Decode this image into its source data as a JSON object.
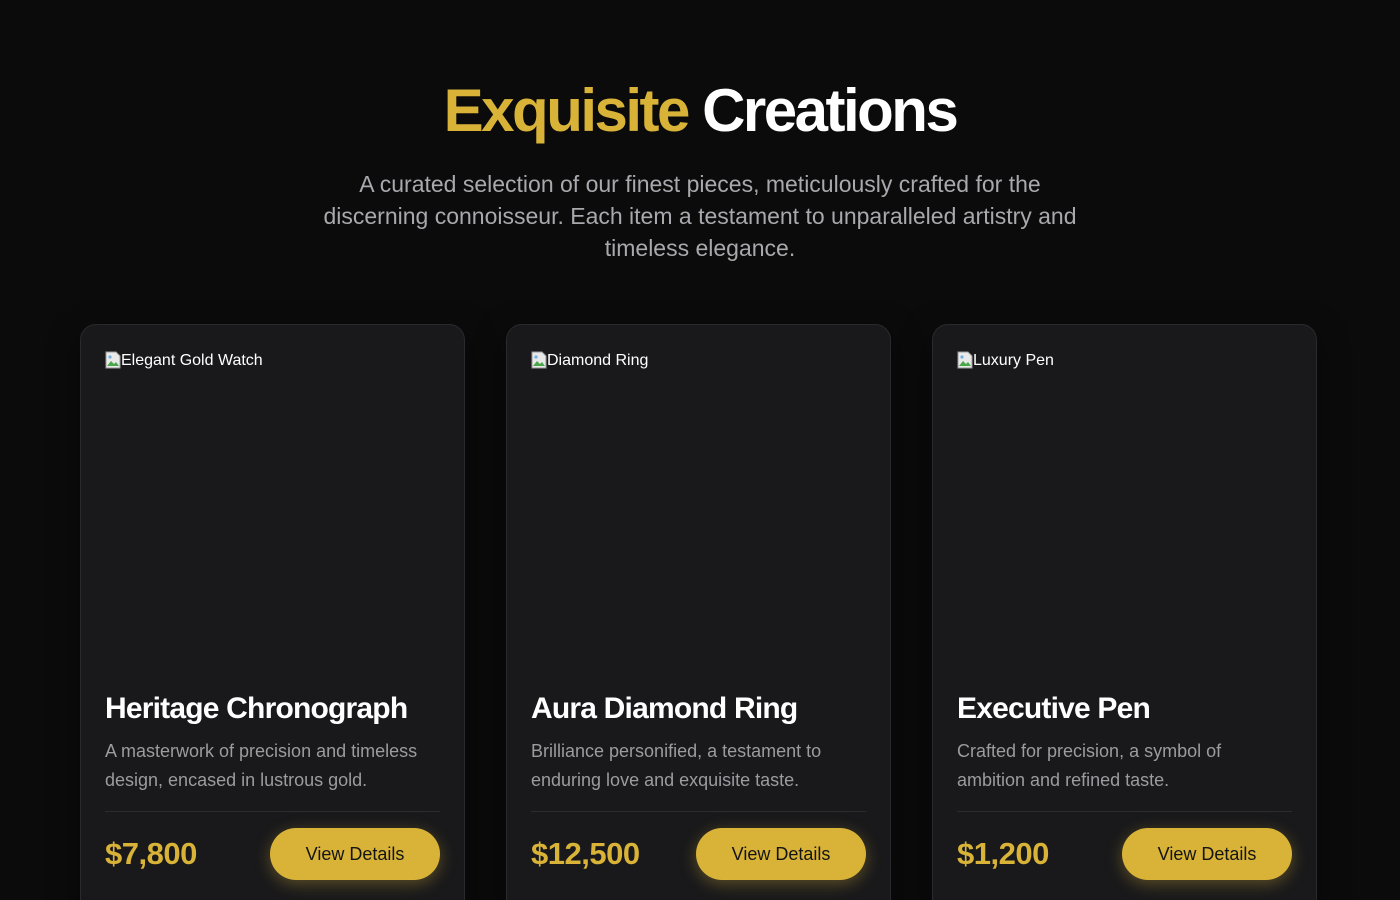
{
  "hero": {
    "title_accent": "Exquisite",
    "title_rest": "Creations",
    "subtitle": "A curated selection of our finest pieces, meticulously crafted for the discerning connoisseur. Each item a testament to unparalleled artistry and timeless elegance."
  },
  "products": [
    {
      "image_alt": "Elegant Gold Watch",
      "name": "Heritage Chronograph",
      "description": "A masterwork of precision and timeless design, encased in lustrous gold.",
      "price": "$7,800",
      "button_label": "View Details"
    },
    {
      "image_alt": "Diamond Ring",
      "name": "Aura Diamond Ring",
      "description": "Brilliance personified, a testament to enduring love and exquisite taste.",
      "price": "$12,500",
      "button_label": "View Details"
    },
    {
      "image_alt": "Luxury Pen",
      "name": "Executive Pen",
      "description": "Crafted for precision, a symbol of ambition and refined taste.",
      "price": "$1,200",
      "button_label": "View Details"
    }
  ],
  "colors": {
    "accent": "#d9b338",
    "background": "#0b0b0b",
    "card": "#19191b"
  }
}
